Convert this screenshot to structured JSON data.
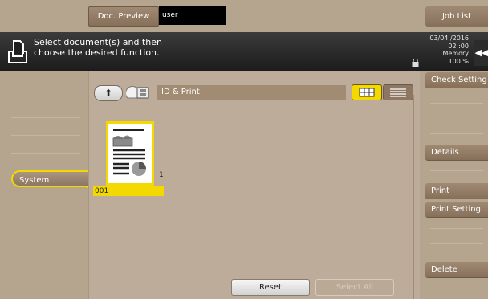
{
  "top_bar": {
    "doc_preview_label": "Doc. Preview",
    "user_label": "user",
    "job_list_label": "Job List"
  },
  "message": {
    "text": "Select document(s) and then\nchoose the desired function.",
    "icon": "box-tray-icon"
  },
  "status": {
    "date": "03/04 /2016",
    "time": "02 :00",
    "memory_label": "Memory",
    "memory_value": "100 %"
  },
  "sidebar": {
    "system_label": "System"
  },
  "main": {
    "path": "ID & Print",
    "documents": [
      {
        "name": "001",
        "count": "1"
      }
    ],
    "reset_label": "Reset",
    "select_all_label": "Select All"
  },
  "right_panel": {
    "check_setting_label": "Check Setting",
    "details_label": "Details",
    "print_label": "Print",
    "print_setting_label": "Print Setting",
    "delete_label": "Delete"
  },
  "colors": {
    "accent": "#f3d900",
    "background": "#b5a48e",
    "message_bar": "#222222"
  }
}
